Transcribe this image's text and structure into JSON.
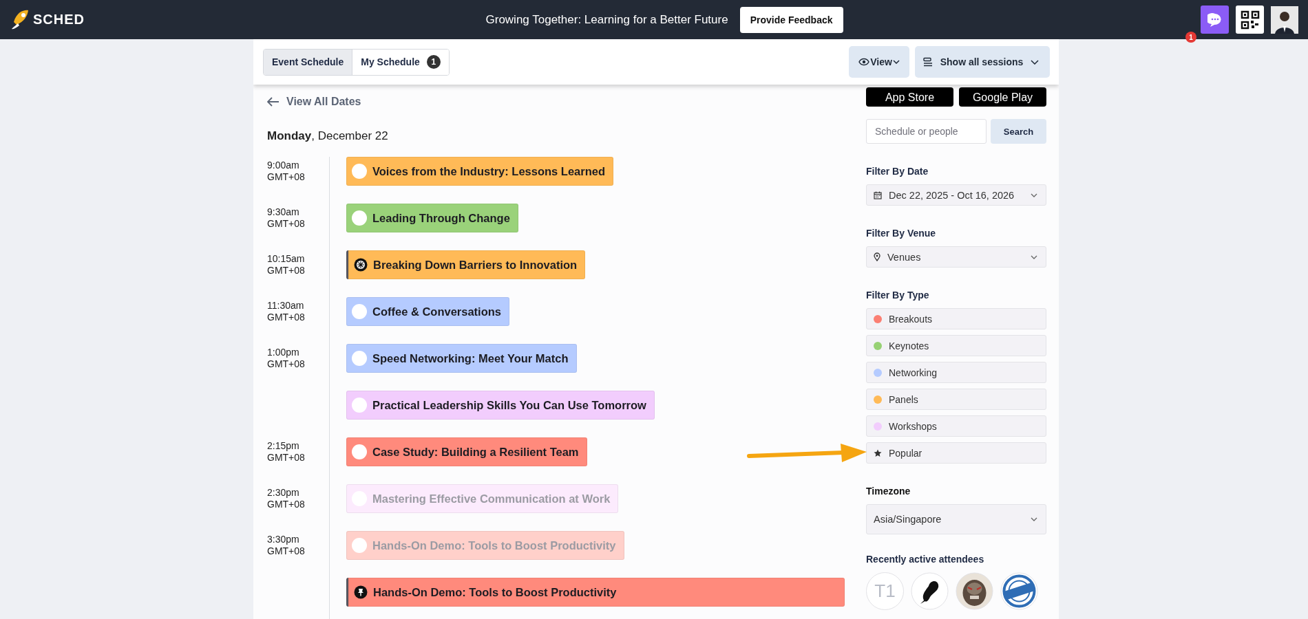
{
  "topbar": {
    "logo": "SCHED",
    "event_title": "Growing Together: Learning for a Better Future",
    "feedback_button": "Provide Feedback",
    "chat_badge": "1"
  },
  "schedule_tabs": [
    {
      "label": "Event Schedule",
      "selected": true
    },
    {
      "label": "My Schedule",
      "selected": false,
      "count": "1"
    }
  ],
  "view_button": "View",
  "sessions_button": "Show all sessions",
  "app_badges": [
    "App Store",
    "Google Play"
  ],
  "back_link": "View All Dates",
  "date_heading": "**Monday**, December 22",
  "sessions": [
    {
      "time": "9:00am",
      "tz": "GMT+08",
      "title": "Voices from the Industry: Lessons Learned",
      "color": "#ffba57",
      "dimmed": false,
      "kind": "circle",
      "full_width": false
    },
    {
      "time": "9:30am",
      "tz": "GMT+08",
      "title": "Leading Through Change",
      "color": "#9ad27a",
      "dimmed": false,
      "kind": "circle",
      "full_width": false
    },
    {
      "time": "10:15am",
      "tz": "GMT+08",
      "title": "Breaking Down Barriers to Innovation",
      "color": "#ffba57",
      "dimmed": false,
      "kind": "burst",
      "full_width": false
    },
    {
      "time": "11:30am",
      "tz": "GMT+08",
      "title": "Coffee & Conversations",
      "color": "#b5cbff",
      "dimmed": false,
      "kind": "circle",
      "full_width": false
    },
    {
      "time": "1:00pm",
      "tz": "GMT+08",
      "title": "Speed Networking: Meet Your Match",
      "color": "#b5cbff",
      "dimmed": false,
      "kind": "circle",
      "full_width": false
    },
    {
      "title": "Practical Leadership Skills You Can Use Tomorrow",
      "color": "#f2cdfd",
      "dimmed": false,
      "kind": "circle",
      "full_width": false
    },
    {
      "time": "2:15pm",
      "tz": "GMT+08",
      "title": "Case Study: Building a Resilient Team",
      "color": "#ff8a7c",
      "dimmed": false,
      "kind": "circle",
      "full_width": false
    },
    {
      "time": "2:30pm",
      "tz": "GMT+08",
      "title": "Mastering Effective Communication at Work",
      "color": "#fcebfd",
      "dimmed": true,
      "kind": "circle",
      "full_width": false
    },
    {
      "time": "3:30pm",
      "tz": "GMT+08",
      "title": "Hands-On Demo: Tools to Boost Productivity",
      "color": "#ffd0ca",
      "dimmed": true,
      "kind": "circle",
      "full_width": false
    },
    {
      "title": "Hands-On Demo: Tools to Boost Productivity",
      "color": "#ff8a7c",
      "dimmed": false,
      "kind": "pin",
      "full_width": true
    }
  ],
  "search": {
    "placeholder": "Schedule or people",
    "button": "Search"
  },
  "filter_date": {
    "heading": "Filter By Date",
    "value": "Dec 22, 2025 - Oct 16, 2026"
  },
  "filter_venue": {
    "heading": "Filter By Venue",
    "value": "Venues"
  },
  "filter_type": {
    "heading": "Filter By Type",
    "types": [
      {
        "label": "Breakouts",
        "kind": "dot",
        "color": "#fb7f73"
      },
      {
        "label": "Keynotes",
        "kind": "dot",
        "color": "#97d174"
      },
      {
        "label": "Networking",
        "kind": "dot",
        "color": "#b5cbff"
      },
      {
        "label": "Panels",
        "kind": "dot",
        "color": "#ffba57"
      },
      {
        "label": "Workshops",
        "kind": "dot",
        "color": "#f2cdfd"
      },
      {
        "label": "Popular",
        "kind": "star"
      }
    ]
  },
  "timezone": {
    "heading": "Timezone",
    "value": "Asia/Singapore"
  },
  "attendees": {
    "heading": "Recently active attendees",
    "items": [
      {
        "kind": "initials",
        "text": "T1"
      },
      {
        "kind": "picture"
      },
      {
        "kind": "picture"
      },
      {
        "kind": "picture"
      }
    ]
  }
}
